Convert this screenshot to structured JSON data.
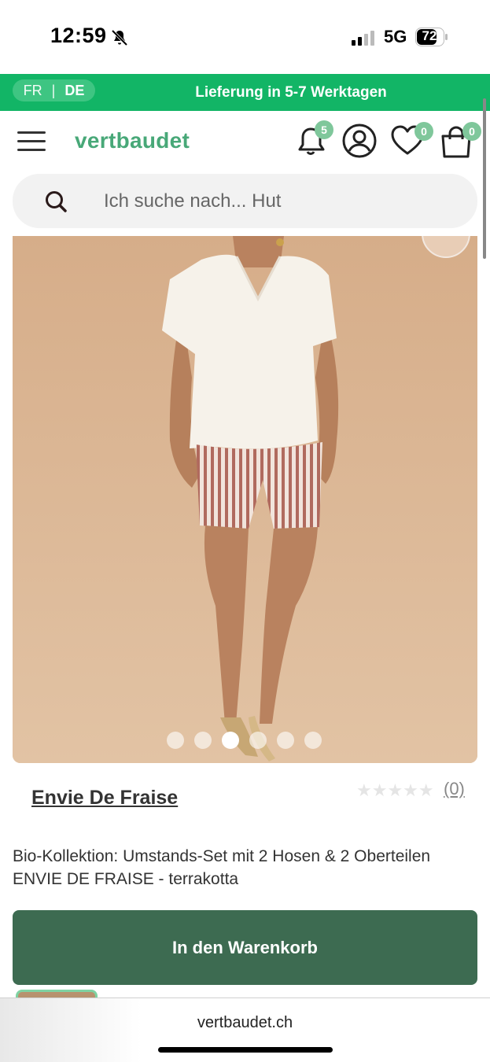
{
  "status_bar": {
    "time": "12:59",
    "network": "5G",
    "battery": "72"
  },
  "banner": {
    "lang_fr": "FR",
    "lang_separator": "|",
    "lang_de": "DE",
    "delivery_text": "Lieferung in 5-7 Werktagen"
  },
  "header": {
    "logo": "vertbaudet",
    "notifications_count": "5",
    "wishlist_count": "0",
    "cart_count": "0"
  },
  "search": {
    "placeholder": "Ich suche nach... Hut"
  },
  "gallery": {
    "image_count": 6,
    "active_index": 2
  },
  "product": {
    "brand": "Envie De Fraise",
    "stars": "★★★★★",
    "review_count": "(0)",
    "title": "Bio-Kollektion: Umstands-Set mit 2 Hosen & 2 Oberteilen ENVIE DE FRAISE - terrakotta",
    "add_to_cart": "In den Warenkorb"
  },
  "browser": {
    "url": "vertbaudet.ch"
  },
  "colors": {
    "banner_green": "#12b566",
    "logo_green": "#48a878",
    "cart_button": "#3d6b51",
    "badge": "#7fc79b"
  }
}
